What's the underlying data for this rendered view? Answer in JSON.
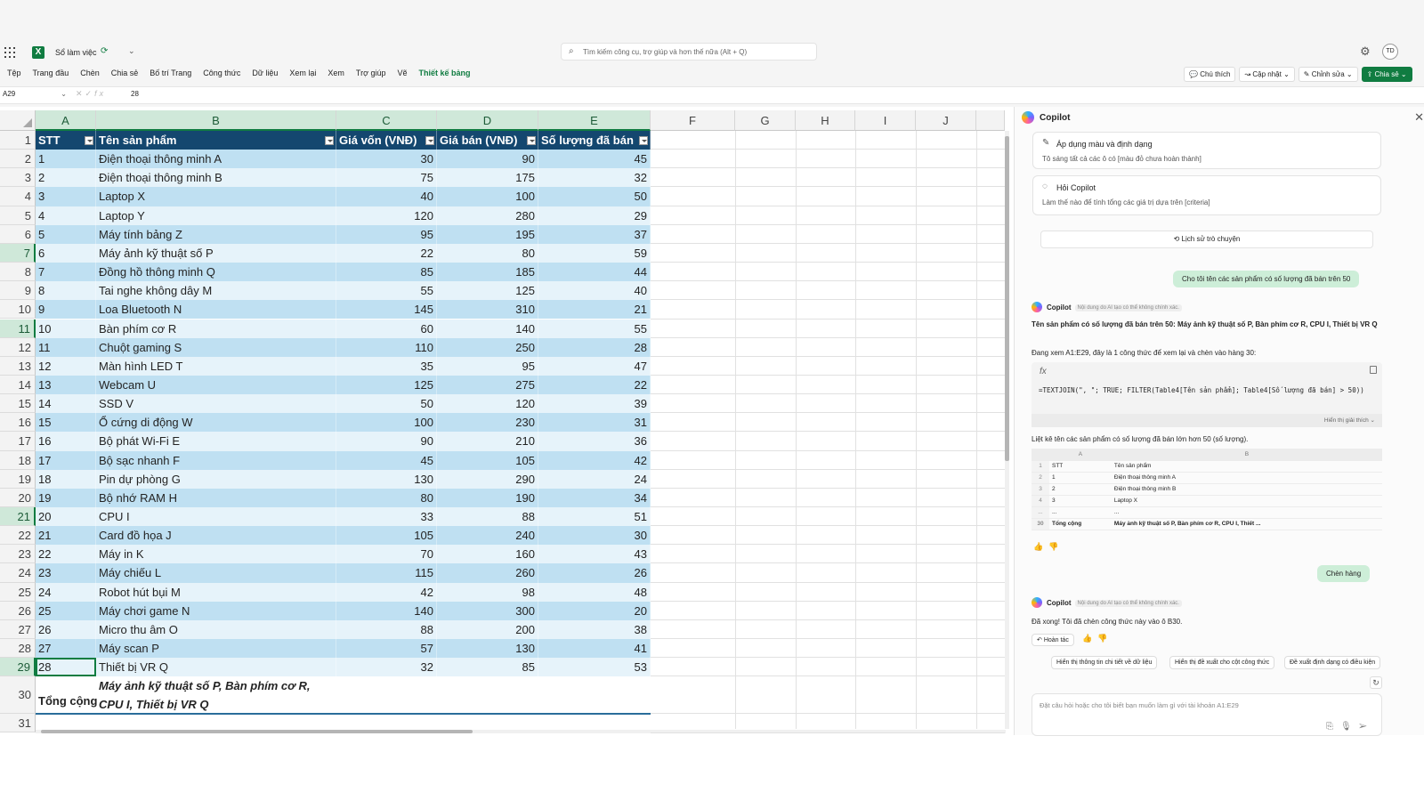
{
  "app": {
    "workbook_name": "Sổ làm việc",
    "search_placeholder": "Tìm kiếm công cụ, trợ giúp và hơn thế nữa (Alt + Q)",
    "avatar_initials": "TD",
    "menu": [
      "Tệp",
      "Trang đầu",
      "Chèn",
      "Chia sẻ",
      "Bố trí Trang",
      "Công thức",
      "Dữ liệu",
      "Xem lại",
      "Xem",
      "Trợ giúp",
      "Vẽ",
      "Thiết kế bảng"
    ],
    "right_buttons": [
      "Chú thích",
      "Cập nhật",
      "Chỉnh sửa",
      "Chia sẻ"
    ],
    "accent": "#107c41"
  },
  "formula_bar": {
    "name_box": "A29",
    "value": "28"
  },
  "sheet": {
    "columns": [
      "A",
      "B",
      "C",
      "D",
      "E",
      "F",
      "G",
      "H",
      "I",
      "J"
    ],
    "row_numbers": [
      "1",
      "2",
      "3",
      "4",
      "5",
      "6",
      "7",
      "8",
      "9",
      "10",
      "11",
      "12",
      "13",
      "14",
      "15",
      "16",
      "17",
      "18",
      "19",
      "20",
      "21",
      "22",
      "23",
      "24",
      "25",
      "26",
      "27",
      "28",
      "29",
      "30",
      "31"
    ],
    "headers": [
      "STT",
      "Tên sản phẩm",
      "Giá vốn (VNĐ)",
      "Giá bán (VNĐ)",
      "Số lượng đã bán"
    ],
    "rows": [
      [
        "1",
        "Điện thoại thông minh A",
        "30",
        "90",
        "45"
      ],
      [
        "2",
        "Điện thoại thông minh B",
        "75",
        "175",
        "32"
      ],
      [
        "3",
        "Laptop X",
        "40",
        "100",
        "50"
      ],
      [
        "4",
        "Laptop Y",
        "120",
        "280",
        "29"
      ],
      [
        "5",
        "Máy tính bảng Z",
        "95",
        "195",
        "37"
      ],
      [
        "6",
        "Máy ảnh kỹ thuật số P",
        "22",
        "80",
        "59"
      ],
      [
        "7",
        "Đồng hồ thông minh Q",
        "85",
        "185",
        "44"
      ],
      [
        "8",
        "Tai nghe không dây M",
        "55",
        "125",
        "40"
      ],
      [
        "9",
        "Loa Bluetooth N",
        "145",
        "310",
        "21"
      ],
      [
        "10",
        "Bàn phím cơ R",
        "60",
        "140",
        "55"
      ],
      [
        "11",
        "Chuột gaming S",
        "110",
        "250",
        "28"
      ],
      [
        "12",
        "Màn hình LED T",
        "35",
        "95",
        "47"
      ],
      [
        "13",
        "Webcam U",
        "125",
        "275",
        "22"
      ],
      [
        "14",
        "SSD V",
        "50",
        "120",
        "39"
      ],
      [
        "15",
        "Ổ cứng di động W",
        "100",
        "230",
        "31"
      ],
      [
        "16",
        "Bộ phát Wi-Fi E",
        "90",
        "210",
        "36"
      ],
      [
        "17",
        "Bộ sạc nhanh F",
        "45",
        "105",
        "42"
      ],
      [
        "18",
        "Pin dự phòng G",
        "130",
        "290",
        "24"
      ],
      [
        "19",
        "Bộ nhớ RAM H",
        "80",
        "190",
        "34"
      ],
      [
        "20",
        "CPU I",
        "33",
        "88",
        "51"
      ],
      [
        "21",
        "Card đồ họa J",
        "105",
        "240",
        "30"
      ],
      [
        "22",
        "Máy in K",
        "70",
        "160",
        "43"
      ],
      [
        "23",
        "Máy chiếu L",
        "115",
        "260",
        "26"
      ],
      [
        "24",
        "Robot hút bụi M",
        "42",
        "98",
        "48"
      ],
      [
        "25",
        "Máy chơi game N",
        "140",
        "300",
        "20"
      ],
      [
        "26",
        "Micro thu âm O",
        "88",
        "200",
        "38"
      ],
      [
        "27",
        "Máy scan P",
        "57",
        "130",
        "41"
      ],
      [
        "28",
        "Thiết bị VR Q",
        "32",
        "85",
        "53"
      ]
    ],
    "total_label": "Tổng cộng",
    "total_value": "Máy ảnh kỹ thuật số P, Bàn phím cơ R, CPU I, Thiết bị VR Q",
    "selected_cell": "A29",
    "band_colors": {
      "header": "#14476f",
      "band_a": "#bfe0f2",
      "band_b": "#e6f3fa"
    }
  },
  "copilot": {
    "title": "Copilot",
    "card1_title": "Áp dụng màu và định dạng",
    "card1_desc": "Tô sáng tất cả các ô có [màu đỏ chưa hoàn thành]",
    "card2_title": "Hỏi Copilot",
    "card2_desc": "Làm thế nào để tính tổng các giá trị dựa trên [criteria]",
    "history": "Lịch sử trò chuyện",
    "user_msg": "Cho tôi tên các sản phẩm có số lượng đã bán trên 50",
    "ai_name": "Copilot",
    "ai_tag": "Nội dung do AI tạo có thể không chính xác.",
    "answer": "Tên sản phẩm có số lượng đã bán trên 50: Máy ảnh kỹ thuật số P, Bàn phím cơ R, CPU I, Thiết bị VR Q",
    "review": "Đang xem A1:E29, đây là 1 công thức để xem lại và chèn vào hàng 30:",
    "formula": "=TEXTJOIN(\", \"; TRUE; FILTER(Table4[Tên sản phẩm]; Table4[Số lượng đã bán] > 50))",
    "show_explain": "Hiển thị giải thích",
    "list_note": "Liệt kê tên các sản phẩm có số lượng đã bán lớn hơn 50 (số lượng).",
    "mini_table": {
      "cols": [
        "A",
        "B"
      ],
      "rows": [
        [
          "1",
          "STT",
          "Tên sản phẩm"
        ],
        [
          "2",
          "1",
          "Điện thoại thông minh A"
        ],
        [
          "3",
          "2",
          "Điện thoại thông minh B"
        ],
        [
          "4",
          "3",
          "Laptop X"
        ],
        [
          "...",
          "...",
          "..."
        ],
        [
          "30",
          "Tổng cộng",
          "Máy ảnh kỹ thuật số P, Bàn phím cơ R, CPU I, Thiết ..."
        ]
      ]
    },
    "insert_btn": "Chèn hàng",
    "done_msg": "Đã xong! Tôi đã chèn công thức này vào ô B30.",
    "undo": "Hoàn tác",
    "suggestions": [
      "Hiển thị thông tin chi tiết về dữ liệu",
      "Hiển thị đề xuất cho cột công thức",
      "Đề xuất định dạng có điều kiện"
    ],
    "prompt_placeholder": "Đặt câu hỏi hoặc cho tôi biết bạn muốn làm gì với tài khoản A1:E29"
  }
}
